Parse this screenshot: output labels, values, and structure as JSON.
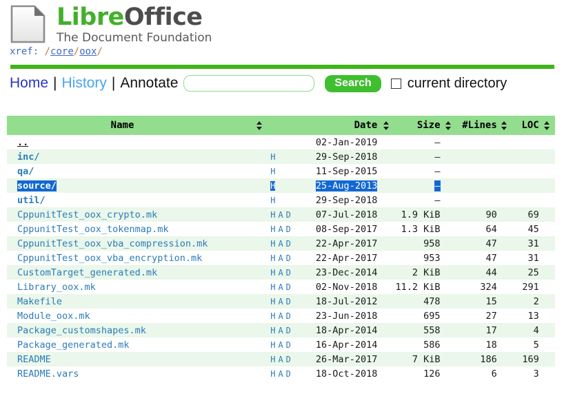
{
  "header": {
    "logo_icon": "document-page-icon",
    "brand_first": "Libre",
    "brand_second": "Office",
    "brand_tagline": "The Document Foundation",
    "xref_label": "xref:",
    "xref_path_parts": [
      "core",
      "oox"
    ],
    "xref_path_full": "/core/oox/",
    "accent_green": "#3fb618",
    "brand_green": "#43b02a",
    "brand_grey": "#4d4d4d"
  },
  "menu": {
    "home_label": "Home",
    "history_label": "History",
    "annotate_label": "Annotate",
    "separator": "|",
    "search_value": "",
    "search_placeholder": "",
    "search_button_label": "Search",
    "current_directory_label": "current directory",
    "current_directory_checked": false
  },
  "table": {
    "header_bg": "#93dd8f",
    "row_alt_bg": "#eaf7ea",
    "link_color": "#2b7bba",
    "selection_color": "#1268d3",
    "columns": [
      {
        "key": "name",
        "label": "Name",
        "sortable": true
      },
      {
        "key": "had",
        "label": "",
        "sortable": false
      },
      {
        "key": "date",
        "label": "Date",
        "sortable": true
      },
      {
        "key": "size",
        "label": "Size",
        "sortable": true
      },
      {
        "key": "lines",
        "label": "#Lines",
        "sortable": true
      },
      {
        "key": "loc",
        "label": "LOC",
        "sortable": true
      }
    ],
    "sort_icon": "sort-updown-icon",
    "history_link_label": "H",
    "annotate_link_label": "A",
    "download_link_label": "D",
    "rows": [
      {
        "name": "..",
        "type": "parent",
        "slash": "",
        "had": "",
        "date": "02-Jan-2019",
        "size": "–",
        "lines": "",
        "loc": "",
        "selected": false
      },
      {
        "name": "inc",
        "type": "dir",
        "slash": "/",
        "had": "H",
        "date": "29-Sep-2018",
        "size": "–",
        "lines": "",
        "loc": "",
        "selected": false
      },
      {
        "name": "qa",
        "type": "dir",
        "slash": "/",
        "had": "H",
        "date": "11-Sep-2015",
        "size": "–",
        "lines": "",
        "loc": "",
        "selected": false
      },
      {
        "name": "source",
        "type": "dir",
        "slash": "/",
        "had": "H",
        "date": "25-Aug-2013",
        "size": "–",
        "lines": "",
        "loc": "",
        "selected": true
      },
      {
        "name": "util",
        "type": "dir",
        "slash": "/",
        "had": "H",
        "date": "29-Sep-2018",
        "size": "–",
        "lines": "",
        "loc": "",
        "selected": false
      },
      {
        "name": "CppunitTest_oox_crypto.mk",
        "type": "file",
        "slash": "",
        "had": "HAD",
        "date": "07-Jul-2018",
        "size": "1.9 KiB",
        "lines": "90",
        "loc": "69",
        "selected": false
      },
      {
        "name": "CppunitTest_oox_tokenmap.mk",
        "type": "file",
        "slash": "",
        "had": "HAD",
        "date": "08-Sep-2017",
        "size": "1.3 KiB",
        "lines": "64",
        "loc": "45",
        "selected": false
      },
      {
        "name": "CppunitTest_oox_vba_compression.mk",
        "type": "file",
        "slash": "",
        "had": "HAD",
        "date": "22-Apr-2017",
        "size": "958",
        "lines": "47",
        "loc": "31",
        "selected": false
      },
      {
        "name": "CppunitTest_oox_vba_encryption.mk",
        "type": "file",
        "slash": "",
        "had": "HAD",
        "date": "22-Apr-2017",
        "size": "953",
        "lines": "47",
        "loc": "31",
        "selected": false
      },
      {
        "name": "CustomTarget_generated.mk",
        "type": "file",
        "slash": "",
        "had": "HAD",
        "date": "23-Dec-2014",
        "size": "2 KiB",
        "lines": "44",
        "loc": "25",
        "selected": false
      },
      {
        "name": "Library_oox.mk",
        "type": "file",
        "slash": "",
        "had": "HAD",
        "date": "02-Nov-2018",
        "size": "11.2 KiB",
        "lines": "324",
        "loc": "291",
        "selected": false
      },
      {
        "name": "Makefile",
        "type": "file",
        "slash": "",
        "had": "HAD",
        "date": "18-Jul-2012",
        "size": "478",
        "lines": "15",
        "loc": "2",
        "selected": false
      },
      {
        "name": "Module_oox.mk",
        "type": "file",
        "slash": "",
        "had": "HAD",
        "date": "23-Jun-2018",
        "size": "695",
        "lines": "27",
        "loc": "13",
        "selected": false
      },
      {
        "name": "Package_customshapes.mk",
        "type": "file",
        "slash": "",
        "had": "HAD",
        "date": "18-Apr-2014",
        "size": "558",
        "lines": "17",
        "loc": "4",
        "selected": false
      },
      {
        "name": "Package_generated.mk",
        "type": "file",
        "slash": "",
        "had": "HAD",
        "date": "16-Apr-2014",
        "size": "586",
        "lines": "18",
        "loc": "5",
        "selected": false
      },
      {
        "name": "README",
        "type": "file",
        "slash": "",
        "had": "HAD",
        "date": "26-Mar-2017",
        "size": "7 KiB",
        "lines": "186",
        "loc": "169",
        "selected": false
      },
      {
        "name": "README.vars",
        "type": "file",
        "slash": "",
        "had": "HAD",
        "date": "18-Oct-2018",
        "size": "126",
        "lines": "6",
        "loc": "3",
        "selected": false
      }
    ]
  }
}
